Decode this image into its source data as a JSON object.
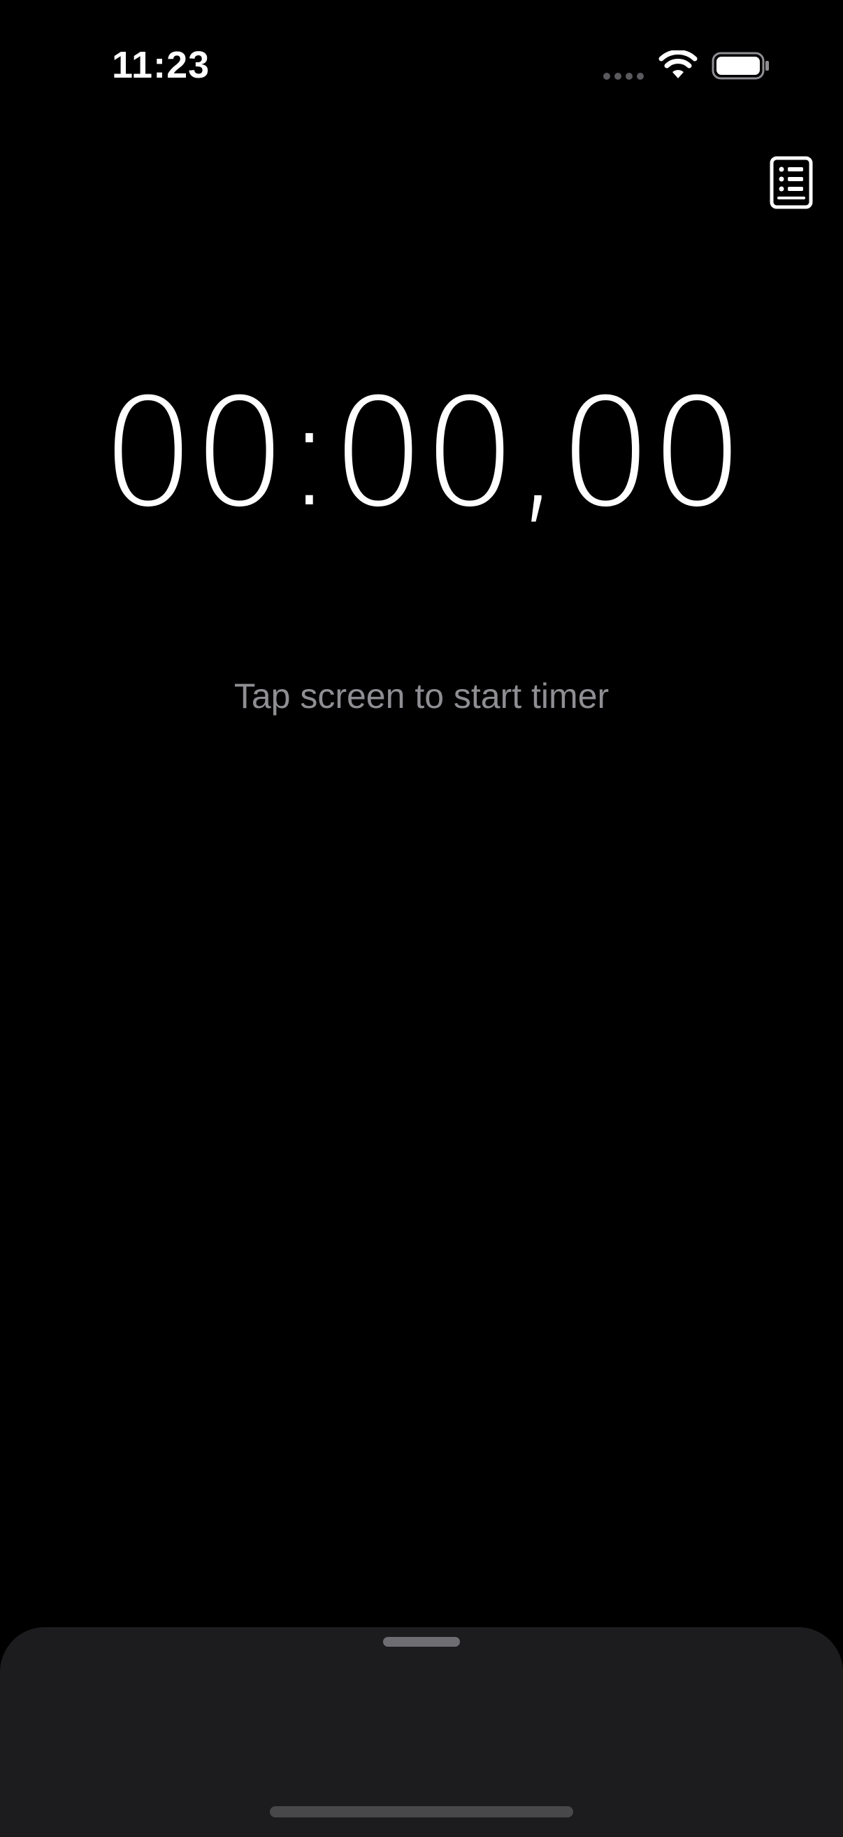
{
  "status_bar": {
    "time": "11:23",
    "icons": [
      "signal-dots-icon",
      "wifi-icon",
      "battery-icon"
    ]
  },
  "header": {
    "history_icon": "list-document-icon"
  },
  "timer": {
    "display": "00:00,00",
    "hint": "Tap screen to start timer"
  },
  "colors": {
    "background": "#000000",
    "text_primary": "#ffffff",
    "text_secondary": "#8e8e93",
    "sheet_background": "#1c1c1e"
  }
}
